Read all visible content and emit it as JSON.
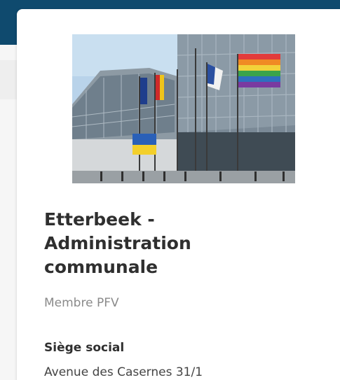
{
  "card": {
    "title": "Etterbeek - Administration communale",
    "membership": "Membre PFV",
    "headquarters_label": "Siège social",
    "headquarters_address": "Avenue des Casernes 31/1"
  },
  "colors": {
    "header_bar": "#0f4a6e",
    "title_text": "#2f2f2f",
    "muted_text": "#8a8a8a"
  }
}
